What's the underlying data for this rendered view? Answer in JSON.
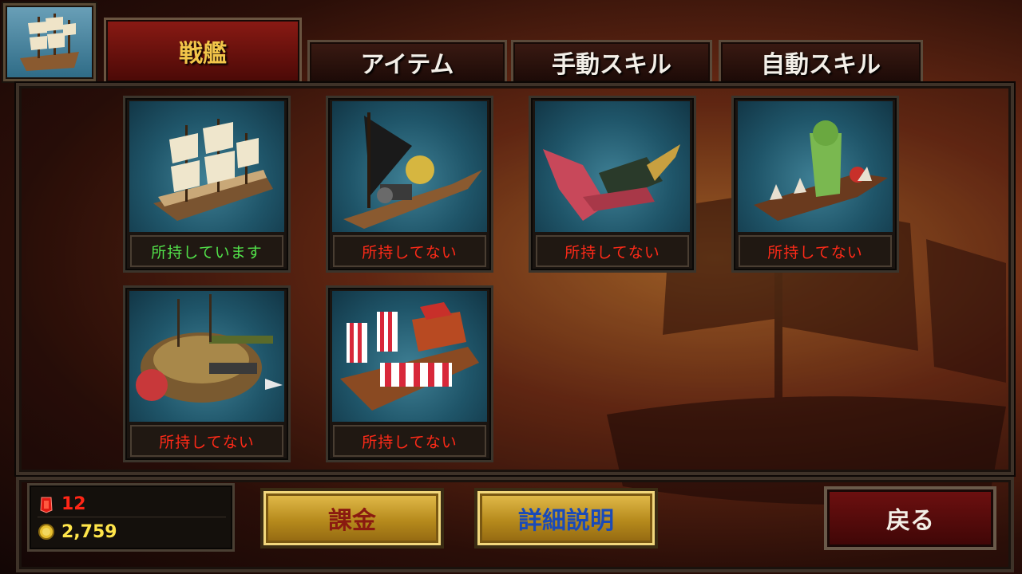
{
  "tabs": [
    {
      "label": "戦艦",
      "active": true
    },
    {
      "label": "アイテム",
      "active": false
    },
    {
      "label": "手動スキル",
      "active": false
    },
    {
      "label": "自動スキル",
      "active": false
    }
  ],
  "ships": [
    {
      "icon": "galleon-ship-icon",
      "status": "所持しています",
      "owned": true
    },
    {
      "icon": "black-sail-gunboat-icon",
      "status": "所持してない",
      "owned": false
    },
    {
      "icon": "dragon-ship-icon",
      "status": "所持してない",
      "owned": false
    },
    {
      "icon": "spiked-plant-ship-icon",
      "status": "所持してない",
      "owned": false
    },
    {
      "icon": "turtle-ship-icon",
      "status": "所持してない",
      "owned": false
    },
    {
      "icon": "japanese-warship-icon",
      "status": "所持してない",
      "owned": false
    }
  ],
  "currency": {
    "gems": "12",
    "gold": "2,759"
  },
  "buttons": {
    "purchase": "課金",
    "details": "詳細説明",
    "back": "戻る"
  },
  "colors": {
    "owned": "#52e24a",
    "not_owned": "#ff2a18",
    "active_tab_text": "#f2c64a",
    "gold_button_text": "#8a1a10",
    "details_button_text": "#1a4ab8"
  }
}
